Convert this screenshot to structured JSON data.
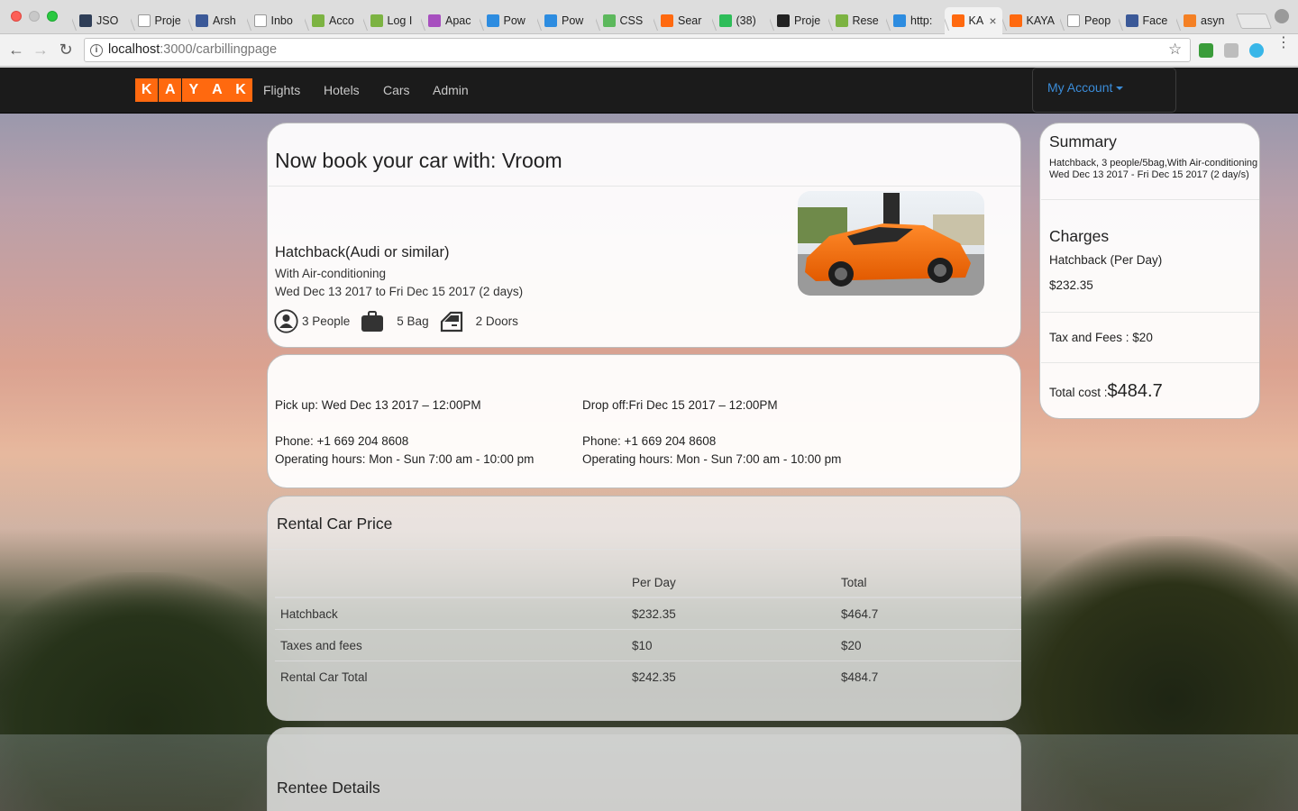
{
  "browser": {
    "tabs": [
      {
        "title": "JSO",
        "fav_color": "#2f3e57",
        "icon": "json-icon"
      },
      {
        "title": "Proje",
        "fav_color": "#ffffff",
        "icon": "lifering-icon"
      },
      {
        "title": "Arsh",
        "fav_color": "#3b5998",
        "icon": "facebook-icon"
      },
      {
        "title": "Inbo",
        "fav_color": "#ffffff",
        "icon": "gmail-icon"
      },
      {
        "title": "Acco",
        "fav_color": "#7cb342",
        "icon": "gear-icon"
      },
      {
        "title": "Log I",
        "fav_color": "#7cb342",
        "icon": "gear-icon"
      },
      {
        "title": "Apac",
        "fav_color": "#a74fbf",
        "icon": "feather-icon"
      },
      {
        "title": "Pow",
        "fav_color": "#2d8ce0",
        "icon": "pdf-icon"
      },
      {
        "title": "Pow",
        "fav_color": "#2d8ce0",
        "icon": "pdf-icon"
      },
      {
        "title": "CSS",
        "fav_color": "#5cb85c",
        "icon": "css-icon"
      },
      {
        "title": "Sear",
        "fav_color": "#ff690f",
        "icon": "kayak-icon"
      },
      {
        "title": "(38)",
        "fav_color": "#2ebd59",
        "icon": "whatsapp-icon"
      },
      {
        "title": "Proje",
        "fav_color": "#222222",
        "icon": "github-icon"
      },
      {
        "title": "Rese",
        "fav_color": "#7cb342",
        "icon": "gear-icon"
      },
      {
        "title": "http:",
        "fav_color": "#2d8ce0",
        "icon": "pdf-icon"
      },
      {
        "title": "KA",
        "fav_color": "#ff690f",
        "icon": "kayak-icon",
        "active": true
      },
      {
        "title": "KAYA",
        "fav_color": "#ff690f",
        "icon": "kayak-icon"
      },
      {
        "title": "Peop",
        "fav_color": "#ffffff",
        "icon": "document-icon"
      },
      {
        "title": "Face",
        "fav_color": "#3b5998",
        "icon": "facebook-icon"
      },
      {
        "title": "asyn",
        "fav_color": "#f48024",
        "icon": "stackoverflow-icon"
      }
    ],
    "url_host": "localhost",
    "url_path": ":3000/carbillingpage"
  },
  "nav": {
    "logo_letters": [
      "K",
      "A",
      "Y",
      "A",
      "K"
    ],
    "links": [
      "Flights",
      "Hotels",
      "Cars",
      "Admin"
    ],
    "account_label": "My Account"
  },
  "booking": {
    "title": "Now book your car with: Vroom",
    "model": "Hatchback(Audi or similar)",
    "ac": "With Air-conditioning",
    "dates": "Wed Dec 13 2017 to Fri Dec 15 2017 (2 days)",
    "people": "3 People",
    "bags": "5 Bag",
    "doors": "2 Doors"
  },
  "locations": {
    "pickup": "Pick up: Wed Dec 13 2017 – 12:00PM",
    "dropoff": "Drop off:Fri Dec 15 2017 – 12:00PM",
    "pickup_phone": "Phone: +1 669 204 8608",
    "dropoff_phone": "Phone: +1 669 204 8608",
    "pickup_hours": "Operating hours: Mon - Sun 7:00 am - 10:00 pm",
    "dropoff_hours": "Operating hours: Mon - Sun 7:00 am - 10:00 pm"
  },
  "price": {
    "title": "Rental Car Price",
    "headers": [
      "",
      "Per Day",
      "Total"
    ],
    "rows": [
      [
        "Hatchback",
        "$232.35",
        "$464.7"
      ],
      [
        "Taxes and fees",
        "$10",
        "$20"
      ],
      [
        "Rental Car Total",
        "$242.35",
        "$484.7"
      ]
    ]
  },
  "rentee": {
    "title": "Rentee Details"
  },
  "summary": {
    "title": "Summary",
    "line1": "Hatchback, 3 people/5bag,With Air-conditioning",
    "line2": "Wed Dec 13 2017 - Fri Dec 15 2017 (2 day/s)",
    "charges_title": "Charges",
    "charge_label": "Hatchback (Per Day)",
    "charge_value": "$232.35",
    "tax_fees": "Tax and Fees : $20",
    "total_label": "Total cost :",
    "total_value": "$484.7"
  }
}
